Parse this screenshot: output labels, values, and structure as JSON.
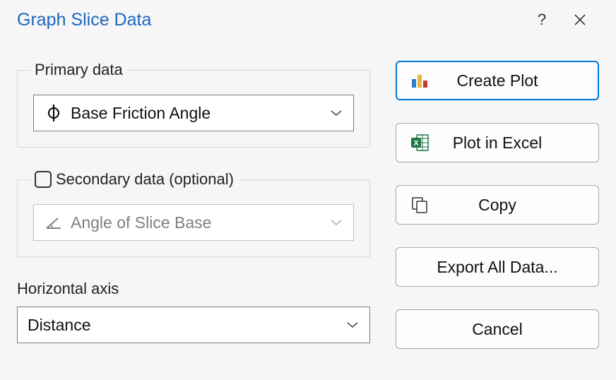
{
  "title": "Graph Slice Data",
  "primary": {
    "legend": "Primary data",
    "icon": "phi-icon",
    "value": "Base Friction Angle"
  },
  "secondary": {
    "legend": "Secondary data (optional)",
    "checked": false,
    "icon": "angle-icon",
    "value": "Angle of Slice Base",
    "enabled": false
  },
  "haxis": {
    "label": "Horizontal axis",
    "value": "Distance"
  },
  "buttons": {
    "create_plot": "Create Plot",
    "plot_excel": "Plot in Excel",
    "copy": "Copy",
    "export_all": "Export All Data...",
    "cancel": "Cancel"
  }
}
